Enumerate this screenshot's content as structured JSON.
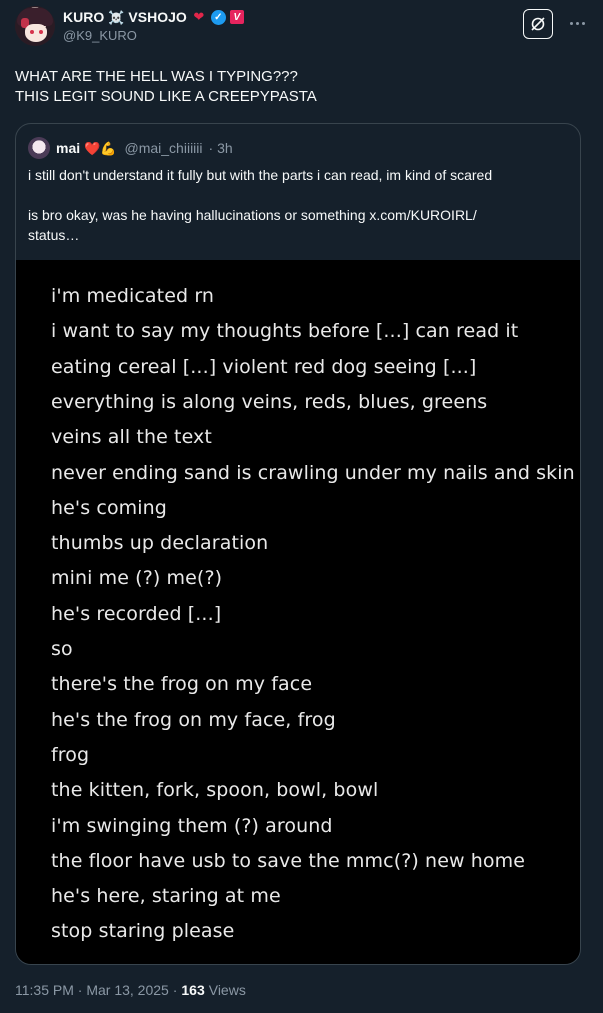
{
  "author": {
    "display_name": "KURO",
    "name_emoji": "☠️",
    "org": "VSHOJO",
    "handle": "@K9_KURO",
    "badge_letter": "V"
  },
  "tweet": {
    "lines": [
      "WHAT ARE THE HELL WAS I TYPING???",
      "THIS LEGIT SOUND LIKE A CREEPYPASTA"
    ]
  },
  "quote": {
    "name": "mai",
    "name_emoji": "❤️💪",
    "handle": "@mai_chiiiiii",
    "time": "· 3h",
    "text_1": "i still don't understand it fully but with the parts i can read, im kind of scared",
    "text_2a": "is bro okay, was he having hallucinations or something  x.com/KUROIRL/",
    "text_2b": "status…",
    "image_lines": [
      "i'm medicated rn",
      "i want to say my thoughts before [...] can read it",
      "eating cereal [...] violent red dog seeing [...]",
      "everything is along veins, reds, blues, greens",
      "veins all the text",
      "never ending sand is crawling under my nails and skin",
      "he's coming",
      "thumbs up declaration",
      "mini me (?) me(?)",
      "he's recorded [...]",
      "so",
      "there's the frog on my face",
      "he's the frog on my face, frog",
      "frog",
      "the kitten, fork, spoon, bowl, bowl",
      "i'm swinging them (?) around",
      "the floor have usb to save the mmc(?) new home",
      "he's here, staring at me",
      "stop staring please"
    ]
  },
  "meta": {
    "timestamp": "11:35 PM · Mar 13, 2025 ·",
    "views_count": "163",
    "views_label": "Views"
  },
  "colors": {
    "background": "#15202b",
    "text": "#f7f9f9",
    "muted": "#8b98a5",
    "border": "#38444d",
    "verified": "#1d9bf0",
    "vshojo": "#e6245e"
  },
  "icons": {
    "grok": "grok-icon",
    "more": "more-icon",
    "verified": "verified-icon"
  }
}
